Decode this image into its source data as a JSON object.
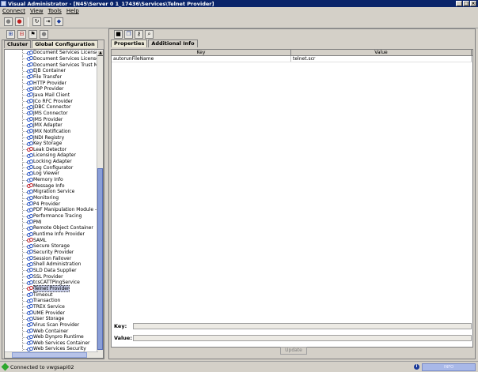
{
  "window": {
    "title": "Visual Administrator - [N45\\Server 0 1_17436\\Services\\Telnet Provider]"
  },
  "menu": [
    "Connect",
    "View",
    "Tools",
    "Help"
  ],
  "left_tabs": [
    "Cluster",
    "Global Configuration"
  ],
  "tree_items": [
    {
      "label": "Document Services License Serv",
      "red": false
    },
    {
      "label": "Document Services License Bu",
      "red": false
    },
    {
      "label": "Document Services Trust Manag",
      "red": false
    },
    {
      "label": "EJB Container",
      "red": false
    },
    {
      "label": "File Transfer",
      "red": false
    },
    {
      "label": "HTTP Provider",
      "red": false
    },
    {
      "label": "IIOP Provider",
      "red": false
    },
    {
      "label": "Java Mail Client",
      "red": false
    },
    {
      "label": "JCo RFC Provider",
      "red": false
    },
    {
      "label": "JDBC Connector",
      "red": false
    },
    {
      "label": "JMS Connector",
      "red": false
    },
    {
      "label": "JMS Provider",
      "red": false
    },
    {
      "label": "JMX Adapter",
      "red": false
    },
    {
      "label": "JMX Notification",
      "red": false
    },
    {
      "label": "JNDI Registry",
      "red": false
    },
    {
      "label": "Key Storage",
      "red": false
    },
    {
      "label": "Leak Detector",
      "red": true
    },
    {
      "label": "Licensing Adapter",
      "red": false
    },
    {
      "label": "Locking Adapter",
      "red": false
    },
    {
      "label": "Log Configurator",
      "red": false
    },
    {
      "label": "Log Viewer",
      "red": false
    },
    {
      "label": "Memory Info",
      "red": false
    },
    {
      "label": "Message Info",
      "red": true
    },
    {
      "label": "Migration Service",
      "red": false
    },
    {
      "label": "Monitoring",
      "red": false
    },
    {
      "label": "P4 Provider",
      "red": false
    },
    {
      "label": "PDF Manipulation Module - Low",
      "red": false
    },
    {
      "label": "Performance Tracing",
      "red": false
    },
    {
      "label": "PMI",
      "red": false
    },
    {
      "label": "Remote Object Container",
      "red": false
    },
    {
      "label": "Runtime Info Provider",
      "red": false
    },
    {
      "label": "SAML",
      "red": true
    },
    {
      "label": "Secure Storage",
      "red": false
    },
    {
      "label": "Security Provider",
      "red": false
    },
    {
      "label": "Session Failover",
      "red": false
    },
    {
      "label": "Shell Administration",
      "red": false
    },
    {
      "label": "SLD Data Supplier",
      "red": false
    },
    {
      "label": "SSL Provider",
      "red": false
    },
    {
      "label": "tcsCATTPingService",
      "red": false
    },
    {
      "label": "Telnet Provider",
      "red": true,
      "selected": true
    },
    {
      "label": "Timeout",
      "red": false
    },
    {
      "label": "Transaction",
      "red": false
    },
    {
      "label": "TREX Service",
      "red": false
    },
    {
      "label": "UME Provider",
      "red": false
    },
    {
      "label": "User Storage",
      "red": false
    },
    {
      "label": "Virus Scan Provider",
      "red": false
    },
    {
      "label": "Web Container",
      "red": false
    },
    {
      "label": "Web Dynpro Runtime",
      "red": false
    },
    {
      "label": "Web Services Container",
      "red": false
    },
    {
      "label": "Web Services Security",
      "red": false
    },
    {
      "label": "XML Form Module",
      "red": false
    }
  ],
  "right_tabs": [
    "Properties",
    "Additional Info"
  ],
  "table": {
    "headers": [
      "Key",
      "Value"
    ],
    "rows": [
      {
        "key": "autorunFileName",
        "value": "telnet.scr"
      }
    ]
  },
  "fields": {
    "key_label": "Key:",
    "value_label": "Value:"
  },
  "update_button": "Update",
  "status": {
    "text": "Connected to vwgsapi02",
    "right_box": "INFO"
  }
}
